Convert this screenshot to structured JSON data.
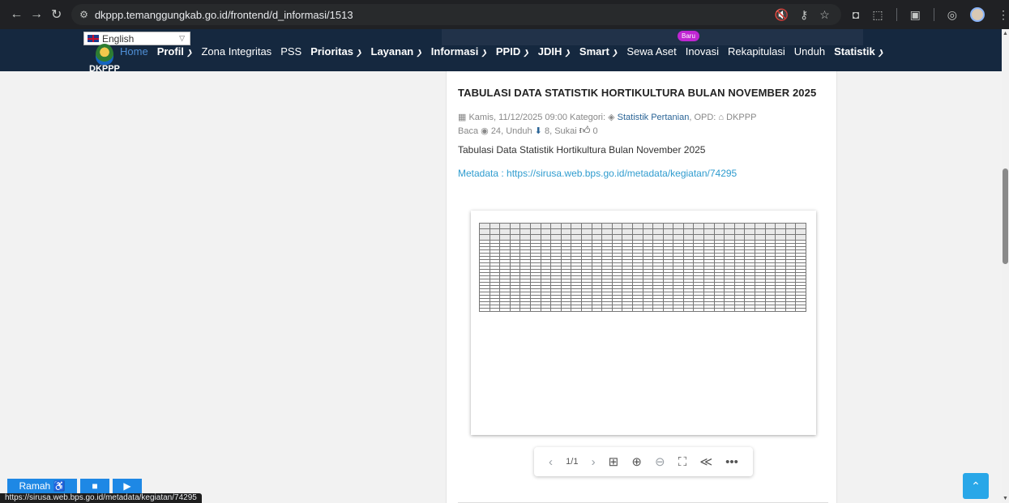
{
  "browser": {
    "url": "dkppp.temanggungkab.go.id/frontend/d_informasi/1513",
    "back_icon": "←",
    "forward_icon": "→",
    "reload_icon": "↻",
    "site_icon": "⚙",
    "omnibox_icons": [
      "🔇",
      "⚷",
      "☆"
    ],
    "extension_icons": [
      "◘",
      "⬚",
      "▣",
      "◎"
    ]
  },
  "language": {
    "selected": "English"
  },
  "site": {
    "logo_text": "DKPPP",
    "baru_badge": "Baru",
    "menu": [
      {
        "label": "Home",
        "dropdown": false
      },
      {
        "label": "Profil",
        "dropdown": true
      },
      {
        "label": "Zona Integritas",
        "dropdown": false
      },
      {
        "label": "PSS",
        "dropdown": false
      },
      {
        "label": "Prioritas",
        "dropdown": true
      },
      {
        "label": "Layanan",
        "dropdown": true
      },
      {
        "label": "Informasi",
        "dropdown": true
      },
      {
        "label": "PPID",
        "dropdown": true
      },
      {
        "label": "JDIH",
        "dropdown": true
      },
      {
        "label": "Smart",
        "dropdown": true
      },
      {
        "label": "Sewa Aset",
        "dropdown": false
      },
      {
        "label": "Inovasi",
        "dropdown": false
      },
      {
        "label": "Rekapitulasi",
        "dropdown": false
      },
      {
        "label": "Unduh",
        "dropdown": false
      },
      {
        "label": "Statistik",
        "dropdown": true
      }
    ]
  },
  "article": {
    "title": "TABULASI DATA STATISTIK HORTIKULTURA BULAN NOVEMBER 2025",
    "date": "Kamis, 11/12/2025 09:00",
    "category_label": "Kategori:",
    "category": "Statistik Pertanian",
    "opd_label": "OPD:",
    "opd": "DKPPP",
    "read_label": "Baca",
    "read_count": "24",
    "download_label": "Unduh",
    "download_count": "8",
    "like_label": "Sukai",
    "like_count": "0",
    "lead": "Tabulasi Data Statistik Hortikultura Bulan November 2025",
    "metadata_label": "Metadata :",
    "metadata_url": "https://sirusa.web.bps.go.id/metadata/kegiatan/74295"
  },
  "viewer": {
    "page_indicator": "1/1",
    "prev_icon": "‹",
    "next_icon": "›",
    "thumbnails_icon": "⊞",
    "zoom_in_icon": "⊕",
    "zoom_out_icon": "⊖",
    "fullscreen_icon": "⛶",
    "share_icon": "≪",
    "more_icon": "•••"
  },
  "accessibility": {
    "ramah": "Ramah ♿",
    "stop_icon": "■",
    "play_icon": "▶"
  },
  "status_url": "https://sirusa.web.bps.go.id/metadata/kegiatan/74295",
  "to_top_icon": "⌃",
  "colors": {
    "navbar": "#15283f",
    "link": "#2f9ccf",
    "accent_button": "#1e88e5",
    "to_top": "#29a7e8",
    "badge": "#c026d3"
  }
}
